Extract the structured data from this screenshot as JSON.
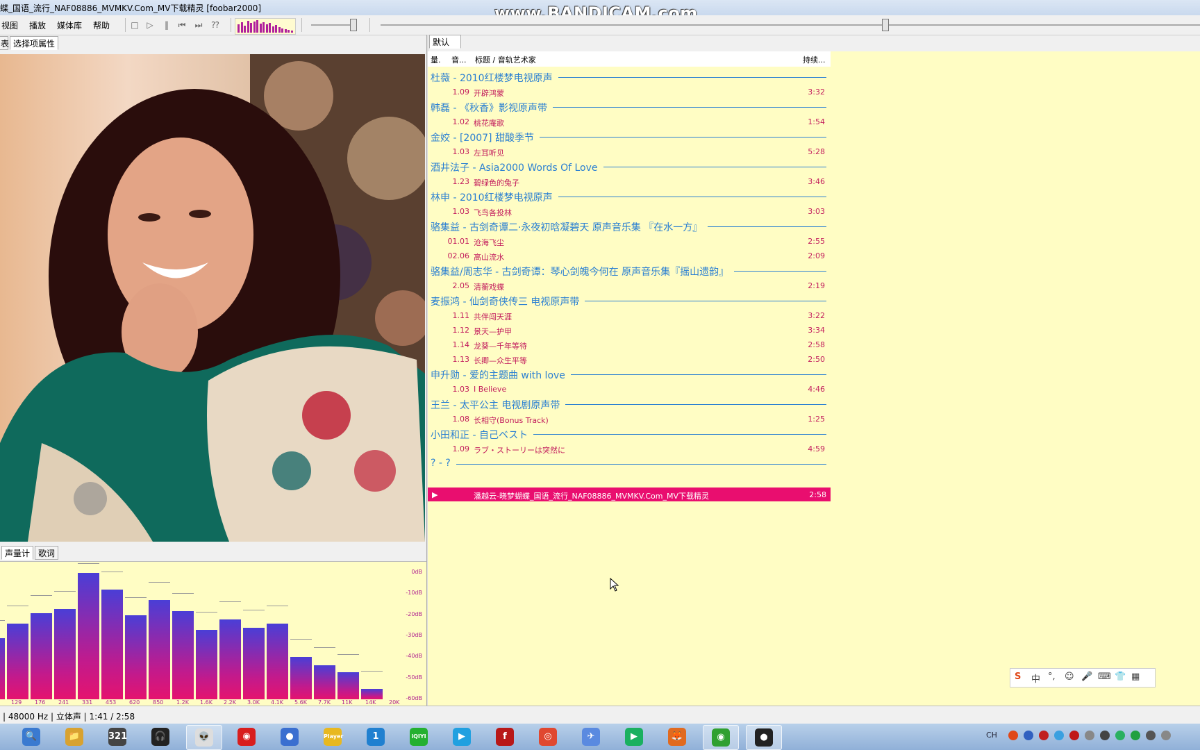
{
  "window": {
    "title": "蝶_国语_流行_NAF08886_MVMKV.Com_MV下载精灵  [foobar2000]",
    "watermark": "www.BANDICAM.com"
  },
  "menu": [
    "视图",
    "播放",
    "媒体库",
    "帮助"
  ],
  "left_tabs": [
    "表",
    "选择项属性"
  ],
  "vis_tabs": [
    "声量计",
    "歌词"
  ],
  "playlist_tab": "默认",
  "columns": {
    "c1": "量.",
    "c2": "音...",
    "c3": "标题 / 音轨艺术家",
    "c4": "持续..."
  },
  "groups": [
    {
      "title": "杜薇 - 2010红楼梦电视原声",
      "tracks": [
        {
          "num": "1.09",
          "name": "开辟鸿蒙",
          "dur": "3:32"
        }
      ]
    },
    {
      "title": "韩磊 - 《秋香》影视原声带",
      "tracks": [
        {
          "num": "1.02",
          "name": "桃花庵歌",
          "dur": "1:54"
        }
      ]
    },
    {
      "title": "金姣 - [2007] 甜酸季节",
      "tracks": [
        {
          "num": "1.03",
          "name": "左耳听见",
          "dur": "5:28"
        }
      ]
    },
    {
      "title": "酒井法子 - Asia2000 Words Of Love",
      "tracks": [
        {
          "num": "1.23",
          "name": "碧绿色的兔子",
          "dur": "3:46"
        }
      ]
    },
    {
      "title": "林申 - 2010红楼梦电视原声",
      "tracks": [
        {
          "num": "1.03",
          "name": "飞鸟各投林",
          "dur": "3:03"
        }
      ]
    },
    {
      "title": "骆集益 - 古剑奇谭二·永夜初晗凝碧天 原声音乐集 『在水一方』",
      "tracks": [
        {
          "num": "01.01",
          "name": "沧海飞尘",
          "dur": "2:55"
        },
        {
          "num": "02.06",
          "name": "高山流水",
          "dur": "2:09"
        }
      ]
    },
    {
      "title": "骆集益/周志华 - 古剑奇谭：琴心剑魄今何在 原声音乐集『摇山遗韵』",
      "tracks": [
        {
          "num": "2.05",
          "name": "清蘅戏蝶",
          "dur": "2:19"
        }
      ]
    },
    {
      "title": "麦振鸿 - 仙剑奇侠传三 电视原声带",
      "tracks": [
        {
          "num": "1.11",
          "name": "共伴闯天涯",
          "dur": "3:22"
        },
        {
          "num": "1.12",
          "name": "景天—护甲",
          "dur": "3:34"
        },
        {
          "num": "1.14",
          "name": "龙葵—千年等待",
          "dur": "2:58"
        },
        {
          "num": "1.13",
          "name": "长卿—众生平等",
          "dur": "2:50"
        }
      ]
    },
    {
      "title": "申升勋 - 爱的主题曲 with love",
      "tracks": [
        {
          "num": "1.03",
          "name": "I Believe",
          "dur": "4:46"
        }
      ]
    },
    {
      "title": "王兰 - 太平公主 电视剧原声带",
      "tracks": [
        {
          "num": "1.08",
          "name": "长相守(Bonus Track)",
          "dur": "1:25"
        }
      ]
    },
    {
      "title": "小田和正 - 自己ベスト",
      "tracks": [
        {
          "num": "1.09",
          "name": "ラブ・ストーリーは突然に",
          "dur": "4:59"
        }
      ]
    },
    {
      "title": "? - ?",
      "tracks": []
    }
  ],
  "now_playing": {
    "name": "潘越云-晓梦蝴蝶_国语_流行_NAF08886_MVMKV.Com_MV下载精灵",
    "dur": "2:58"
  },
  "spectrum": {
    "db_labels": [
      "0dB",
      "-10dB",
      "-20dB",
      "-30dB",
      "-40dB",
      "-50dB",
      "-60dB"
    ],
    "freq_labels": [
      "129",
      "176",
      "241",
      "331",
      "453",
      "620",
      "850",
      "1.2K",
      "1.6K",
      "2.2K",
      "3.0K",
      "4.1K",
      "5.6K",
      "7.7K",
      "11K",
      "14K",
      "20K"
    ],
    "levels_db": [
      -31,
      -24,
      -19,
      -17,
      0,
      -8,
      -20,
      -13,
      -18,
      -27,
      -22,
      -26,
      -24,
      -40,
      -44,
      -47,
      -55
    ]
  },
  "status": "| 48000 Hz | 立体声 | 1:41 / 2:58",
  "ime": {
    "items": [
      "S",
      "中",
      "°,",
      "☺",
      "🎤",
      "⌨",
      "👕",
      "▦"
    ]
  },
  "tray": {
    "lang": "CH"
  },
  "colors": {
    "playlist_bg": "#fffdc4",
    "group": "#2a7fd2",
    "track": "#c21a5c",
    "playing": "#e90e6f"
  },
  "taskbar_apps": [
    {
      "name": "search-app-icon",
      "label": "🔍",
      "color": "#3a7ad0"
    },
    {
      "name": "explorer-icon",
      "label": "📁",
      "color": "#d8a230"
    },
    {
      "name": "calendar-icon",
      "label": "321",
      "color": "#444"
    },
    {
      "name": "headphones-icon",
      "label": "🎧",
      "color": "#222"
    },
    {
      "name": "alien-app-icon",
      "label": "👽",
      "color": "#ddd"
    },
    {
      "name": "netease-music-icon",
      "label": "◉",
      "color": "#d81e1e"
    },
    {
      "name": "media-icon",
      "label": "●",
      "color": "#3a6fd0"
    },
    {
      "name": "player-icon",
      "label": "Player",
      "color": "#e8b820"
    },
    {
      "name": "app-1-icon",
      "label": "1",
      "color": "#2080d0"
    },
    {
      "name": "iqiyi-icon",
      "label": "iQIYI",
      "color": "#24b030"
    },
    {
      "name": "youku-icon",
      "label": "▶",
      "color": "#20a0e0"
    },
    {
      "name": "flash-icon",
      "label": "f",
      "color": "#b81818"
    },
    {
      "name": "chrome-icon",
      "label": "◎",
      "color": "#e04830"
    },
    {
      "name": "bird-app-icon",
      "label": "✈",
      "color": "#5a8ae0"
    },
    {
      "name": "play-store-icon",
      "label": "▶",
      "color": "#1ab060"
    },
    {
      "name": "firefox-icon",
      "label": "🦊",
      "color": "#e06a20"
    },
    {
      "name": "foobar-icon",
      "label": "◉",
      "color": "#30a030"
    },
    {
      "name": "recorder-icon",
      "label": "●",
      "color": "#222"
    }
  ]
}
